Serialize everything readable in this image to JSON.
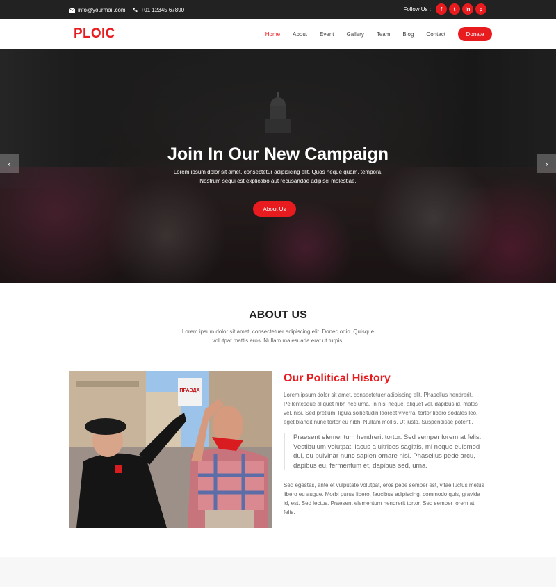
{
  "topbar": {
    "email": "info@yourmail.com",
    "phone": "+01 12345 67890",
    "follow_label": "Follow Us :",
    "social": [
      "f",
      "t",
      "in",
      "p"
    ],
    "icons": {
      "email": "envelope-icon",
      "phone": "phone-icon"
    },
    "bg_color": "#222222"
  },
  "nav": {
    "logo": "PLOIC",
    "items": [
      {
        "label": "Home",
        "active": true
      },
      {
        "label": "About"
      },
      {
        "label": "Event"
      },
      {
        "label": "Gallery"
      },
      {
        "label": "Team"
      },
      {
        "label": "Blog"
      },
      {
        "label": "Contact"
      }
    ],
    "donate": "Donate"
  },
  "hero": {
    "title": "Join In Our New Campaign",
    "description": "Lorem ipsum dolor sit amet, consectetur adipisicing elit. Quos neque quam, tempora. Nostrum sequi est explicabo aut recusandae adipisci molestiae.",
    "button": "About Us",
    "prev_icon": "chevron-left-icon",
    "next_icon": "chevron-right-icon"
  },
  "about": {
    "title": "ABOUT US",
    "description": "Lorem ipsum dolor sit amet, consectetuer adipiscing elit. Donec odio. Quisque volutpat mattis eros. Nullam malesuada erat ut turpis."
  },
  "history": {
    "title": "Our Political History",
    "paragraph1": "Lorem ipsum dolor sit amet, consectetuer adipiscing elit. Phasellus hendrerit. Pellentesque aliquet nibh nec urna. In nisi neque, aliquet vel, dapibus id, mattis vel, nisi. Sed pretium, ligula sollicitudin laoreet viverra, tortor libero sodales leo, eget blandit nunc tortor eu nibh. Nullam mollis. Ut justo. Suspendisse potenti.",
    "quote": "Praesent elementum hendrerit tortor. Sed semper lorem at felis. Vestibulum volutpat, lacus a ultrices sagittis, mi neque euismod dui, eu pulvinar nunc sapien ornare nisl. Phasellus pede arcu, dapibus eu, fermentum et, dapibus sed, urna.",
    "paragraph2": "Sed egestas, ante et vulputate volutpat, eros pede semper est, vitae luctus metus libero eu augue. Morbi purus libero, faucibus adipiscing, commodo quis, gravida id, est. Sed lectus. Praesent elementum hendrerit tortor. Sed semper lorem at felis.",
    "photo_sign": "ПРАВДА"
  },
  "colors": {
    "accent": "#e81b1f",
    "text": "#666666",
    "heading": "#222222"
  }
}
